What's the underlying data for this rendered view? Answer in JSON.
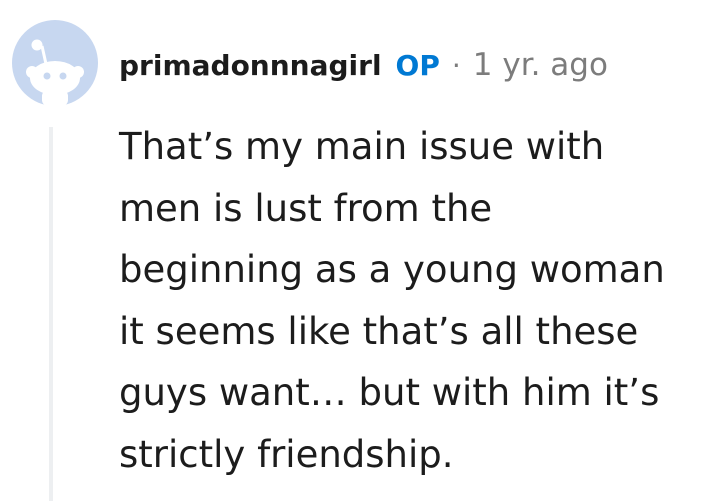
{
  "comment": {
    "author": "primadonnnagirl",
    "op_label": "OP",
    "separator": "·",
    "timestamp": "1 yr. ago",
    "body_lines": [
      "That’s my main issue with",
      "men is lust from the",
      "beginning as a young woman",
      "it seems like that’s all these",
      "guys want… but with him it’s",
      "strictly friendship."
    ]
  },
  "colors": {
    "avatar_bg": "#c7d7f0",
    "snoo": "#ffffff",
    "op_badge": "#0079d3",
    "meta_text": "#7c7c7c",
    "thread_line": "#edeff1"
  }
}
